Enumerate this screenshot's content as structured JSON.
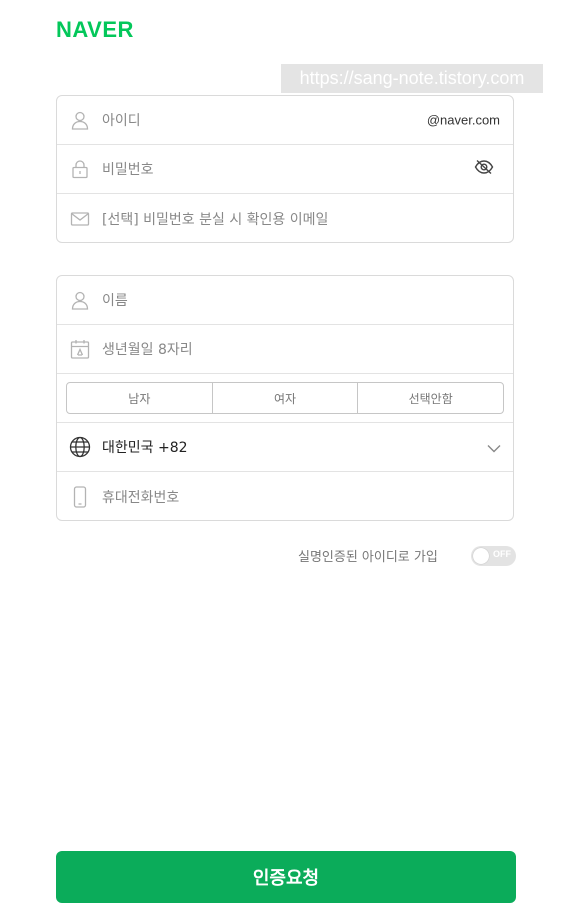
{
  "brand": {
    "logo": "NAVER",
    "color": "#03c75a"
  },
  "watermark": "https://sang-note.tistory.com",
  "account": {
    "id_placeholder": "아이디",
    "id_suffix": "@naver.com",
    "password_placeholder": "비밀번호",
    "email_placeholder": "[선택] 비밀번호 분실 시 확인용 이메일"
  },
  "profile": {
    "name_placeholder": "이름",
    "birth_placeholder": "생년월일 8자리",
    "gender_options": [
      "남자",
      "여자",
      "선택안함"
    ],
    "country": "대한민국 +82",
    "phone_placeholder": "휴대전화번호"
  },
  "verify": {
    "label": "실명인증된 아이디로 가입",
    "toggle_state": "OFF"
  },
  "submit_label": "인증요청",
  "icons": [
    "user-icon",
    "lock-icon",
    "mail-icon",
    "calendar-icon",
    "globe-icon",
    "phone-icon",
    "eye-off-icon",
    "chevron-down-icon"
  ],
  "colors": {
    "button": "#0bac5a",
    "border": "#dadada",
    "toggle_off": "#e3e3e3"
  }
}
